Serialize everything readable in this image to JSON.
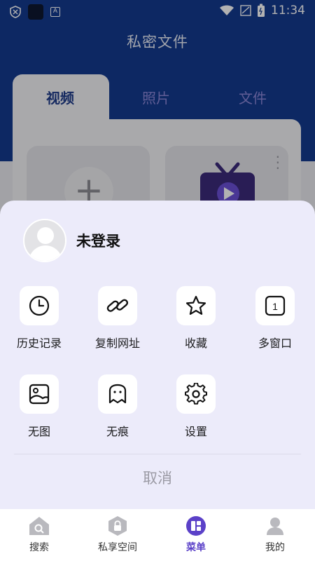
{
  "status_bar": {
    "time": "11:34"
  },
  "app": {
    "title": "私密文件",
    "tabs": [
      {
        "label": "视频",
        "active": true
      },
      {
        "label": "照片",
        "active": false
      },
      {
        "label": "文件",
        "active": false
      }
    ]
  },
  "sheet": {
    "user": {
      "status": "未登录"
    },
    "menu": [
      {
        "label": "历史记录",
        "icon": "clock-icon"
      },
      {
        "label": "复制网址",
        "icon": "link-icon"
      },
      {
        "label": "收藏",
        "icon": "star-icon"
      },
      {
        "label": "多窗口",
        "icon": "window-count-icon",
        "badge": "1"
      },
      {
        "label": "无图",
        "icon": "image-icon"
      },
      {
        "label": "无痕",
        "icon": "ghost-icon"
      },
      {
        "label": "设置",
        "icon": "gear-icon"
      }
    ],
    "cancel_label": "取消"
  },
  "bottom_nav": [
    {
      "label": "搜索",
      "icon": "search-home-icon",
      "active": false
    },
    {
      "label": "私享空间",
      "icon": "lock-shield-icon",
      "active": false
    },
    {
      "label": "菜单",
      "icon": "menu-grid-icon",
      "active": true
    },
    {
      "label": "我的",
      "icon": "profile-icon",
      "active": false
    }
  ],
  "colors": {
    "header_blue": "#143a8f",
    "accent_purple": "#5b41c8",
    "sheet_bg": "#ecebfa"
  }
}
